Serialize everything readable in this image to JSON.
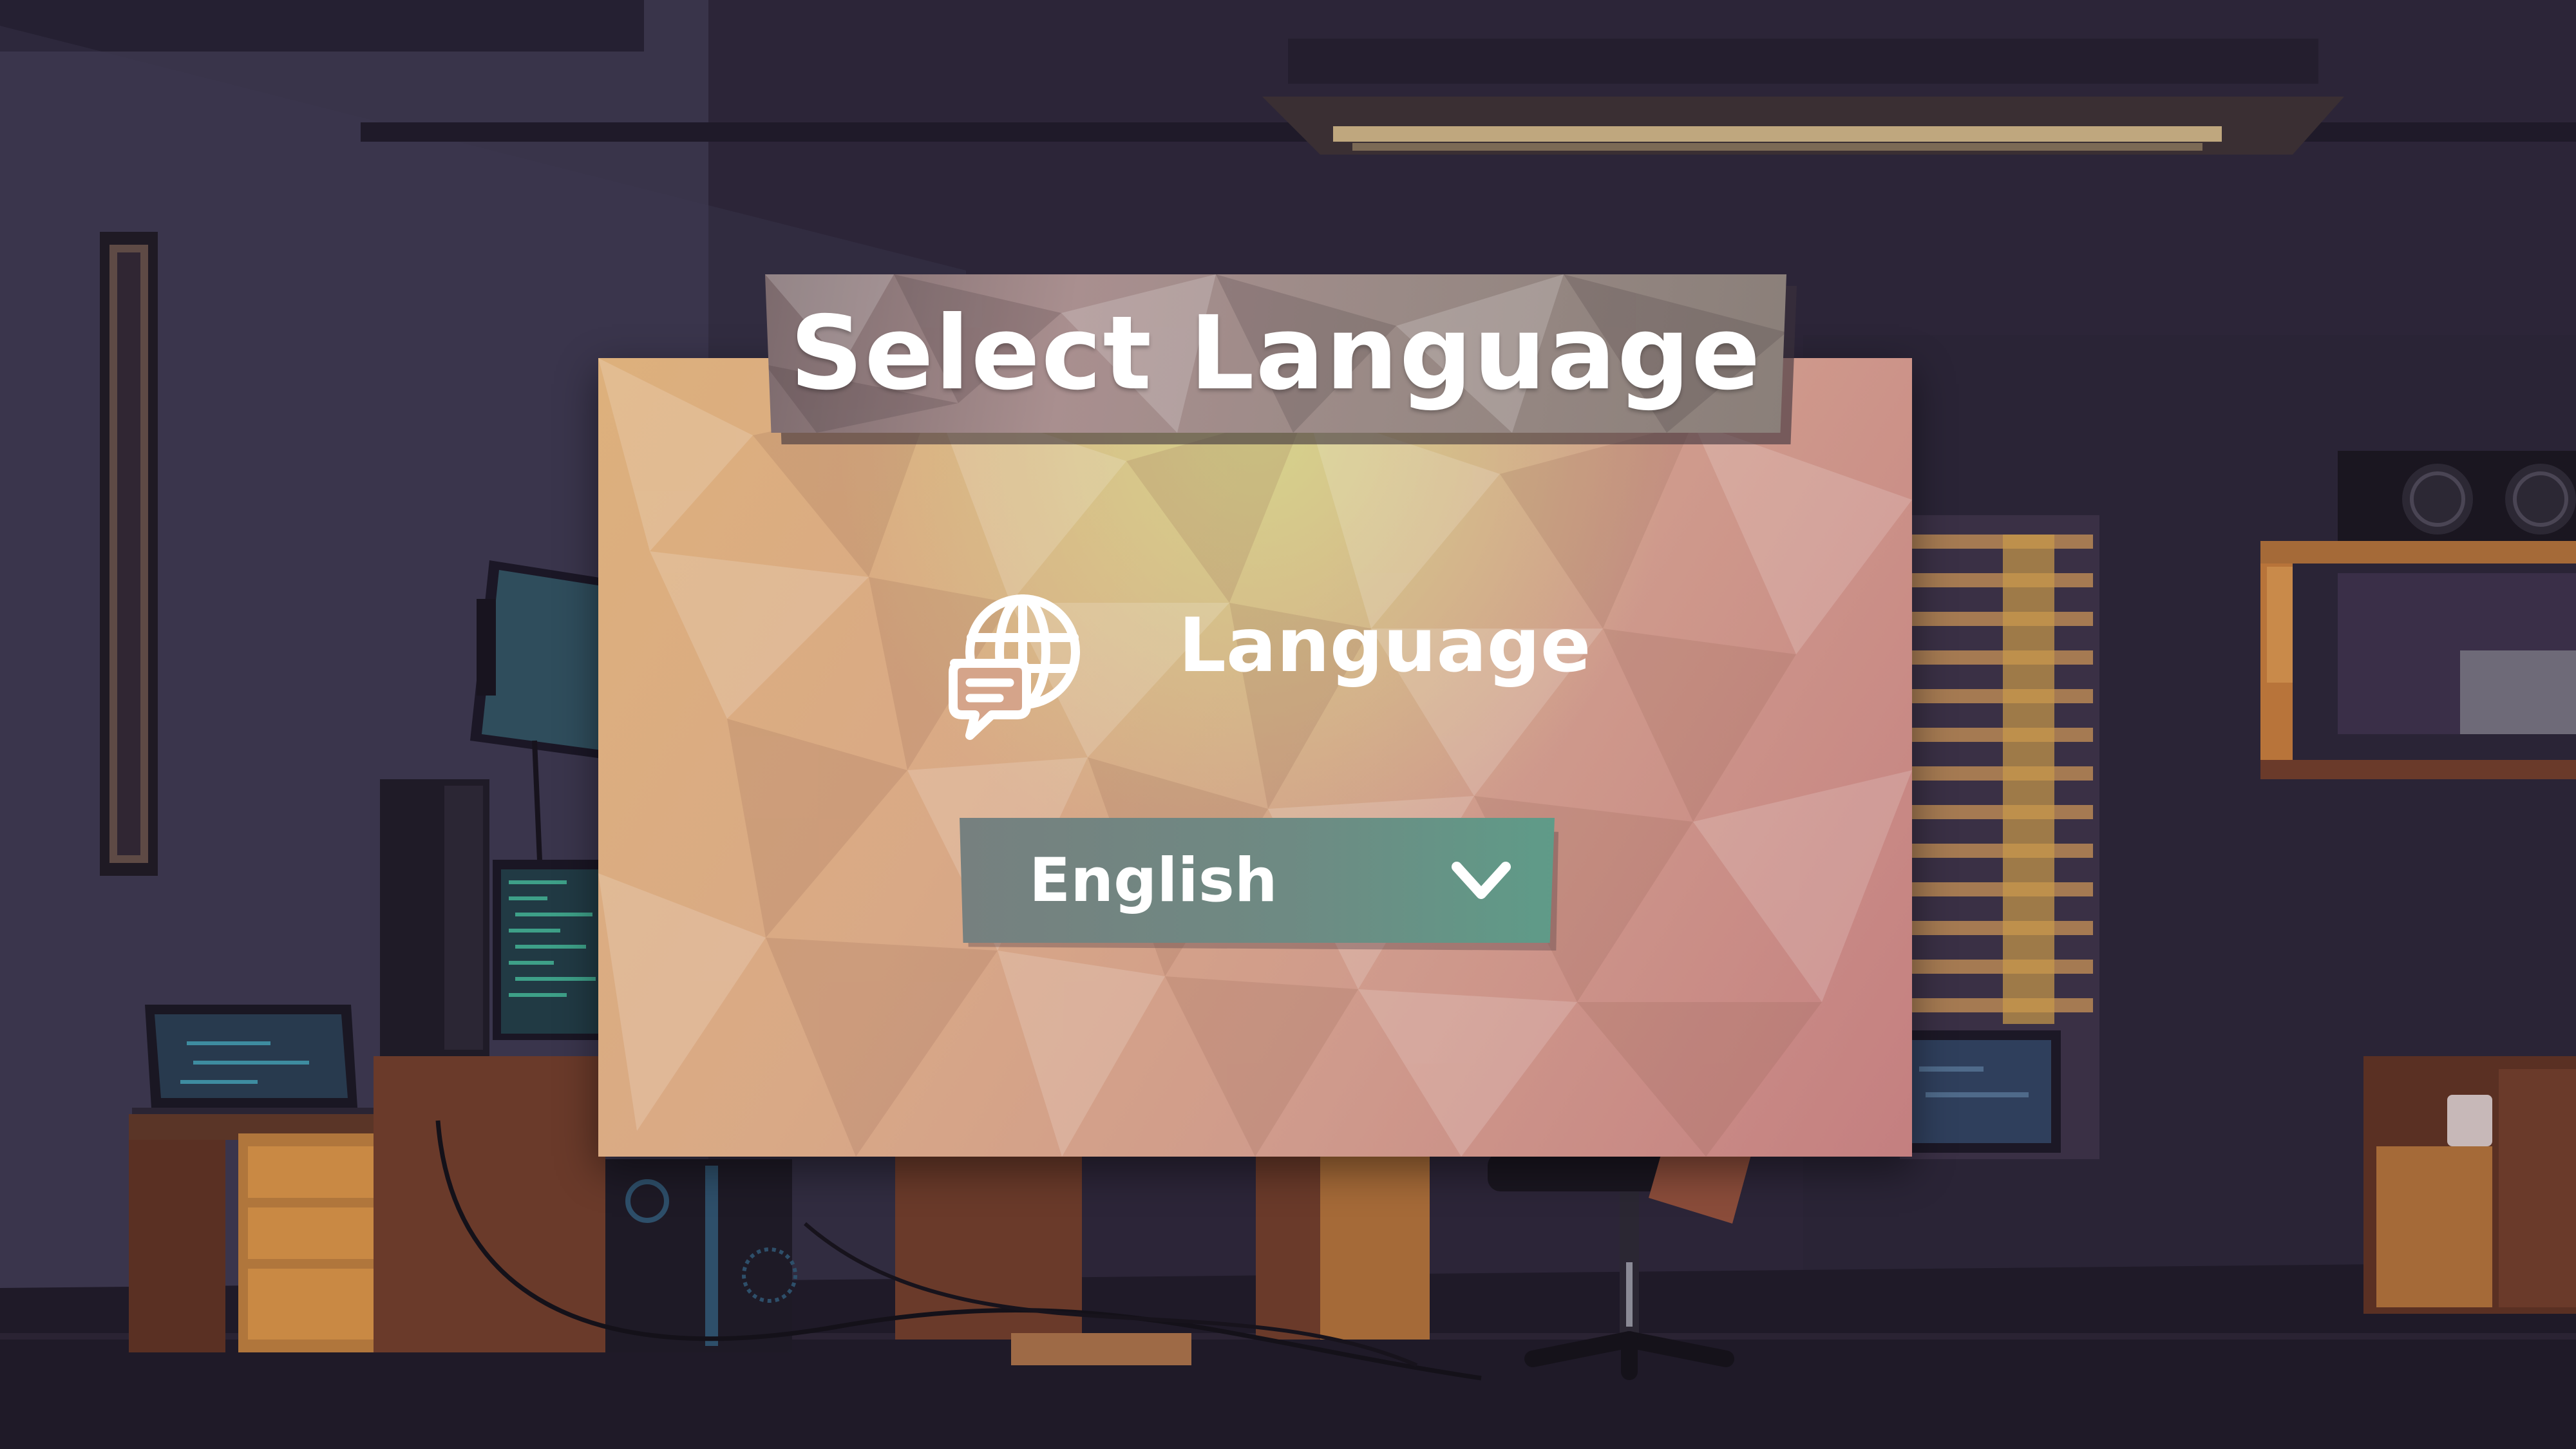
{
  "dialog": {
    "title": "Select Language",
    "language_label": "Language",
    "language_icon": "globe-chat-icon",
    "dropdown": {
      "selected_value": "English",
      "icon": "chevron-down-icon"
    }
  },
  "colors": {
    "card_top": "#d6cc8c",
    "card_left": "#ddb07c",
    "card_right": "#c47f80",
    "title_banner": "#9a8686",
    "dropdown_left": "#76807f",
    "dropdown_right": "#5f9b88",
    "text": "#ffffff",
    "room_background": "#2a2438"
  }
}
